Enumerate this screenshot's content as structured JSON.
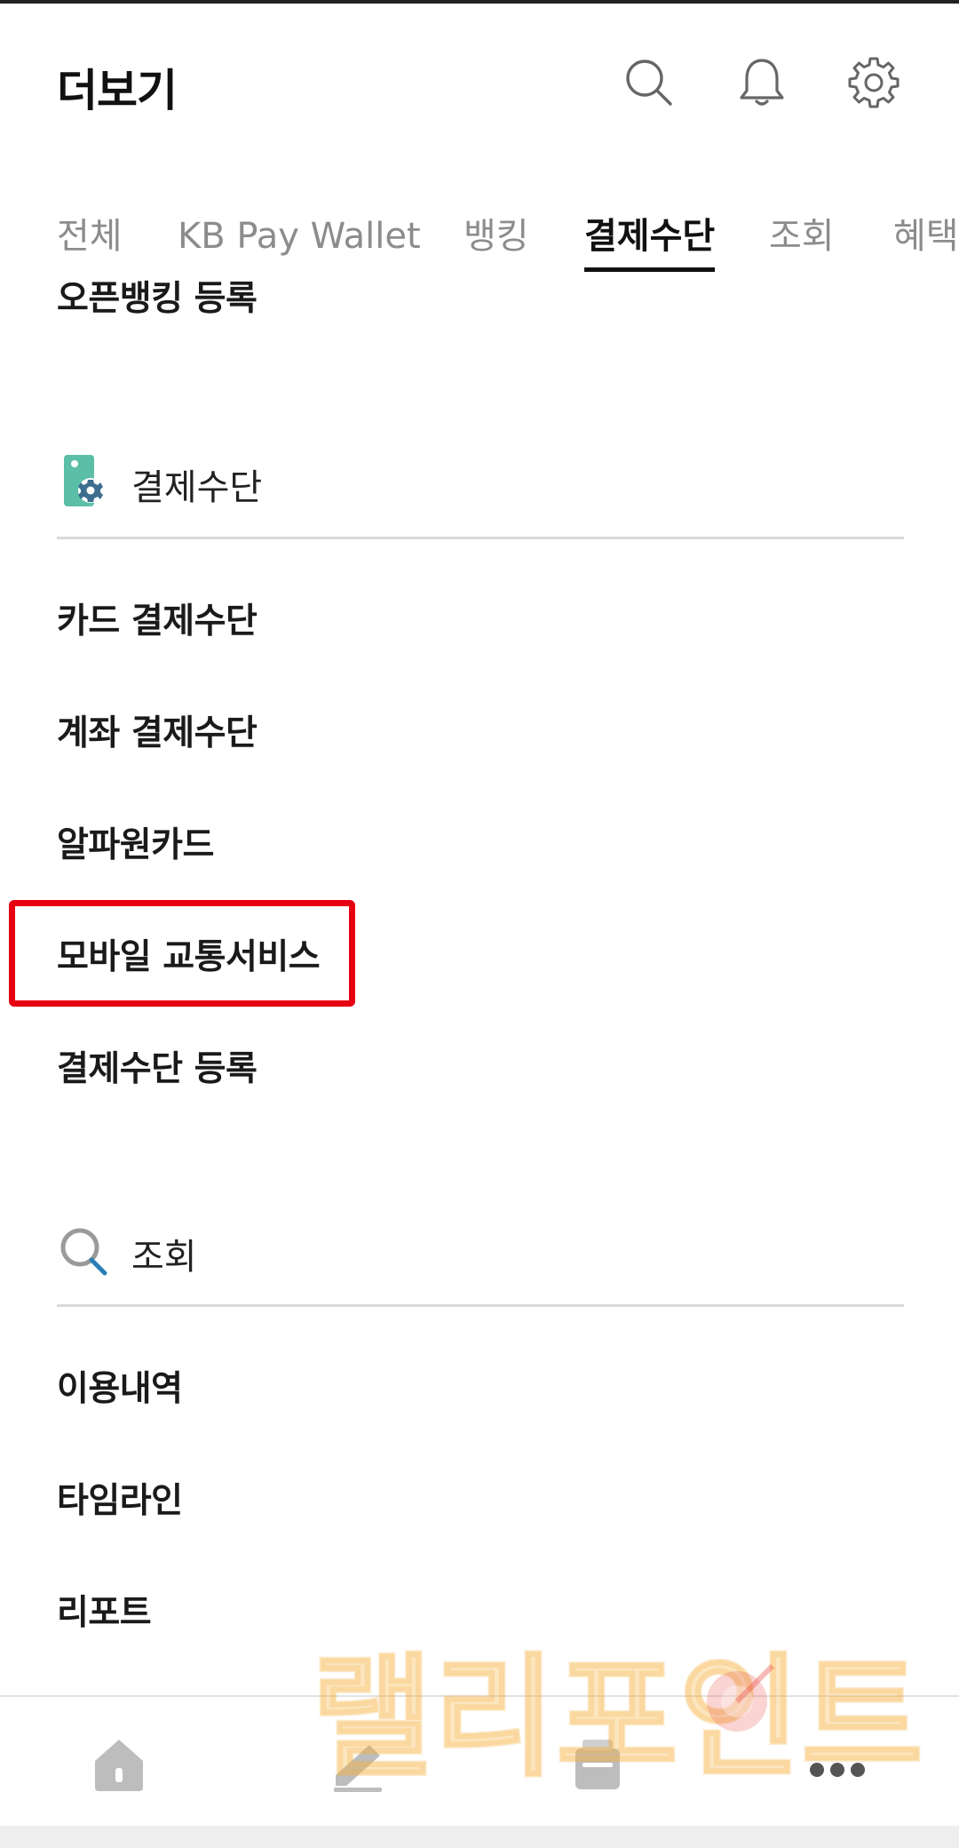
{
  "header": {
    "title": "더보기"
  },
  "tabs": [
    {
      "label": "전체"
    },
    {
      "label": "KB Pay Wallet"
    },
    {
      "label": "뱅킹"
    },
    {
      "label": "결제수단",
      "active": true
    },
    {
      "label": "조회"
    },
    {
      "label": "혜택"
    }
  ],
  "open_banking": {
    "label": "오픈뱅킹 등록"
  },
  "payment_section": {
    "title": "결제수단",
    "items": [
      {
        "label": "카드 결제수단"
      },
      {
        "label": "계좌 결제수단"
      },
      {
        "label": "알파원카드"
      },
      {
        "label": "모바일 교통서비스",
        "highlighted": true
      },
      {
        "label": "결제수단 등록"
      }
    ]
  },
  "inquiry_section": {
    "title": "조회",
    "items": [
      {
        "label": "이용내역"
      },
      {
        "label": "타임라인"
      },
      {
        "label": "리포트"
      }
    ]
  },
  "watermark": {
    "text": "랠리포인트"
  },
  "colors": {
    "highlight": "#e60012",
    "payment_icon": "#5bbfa8",
    "gear_icon": "#3d6e8f",
    "watermark": "#f5b13a"
  }
}
